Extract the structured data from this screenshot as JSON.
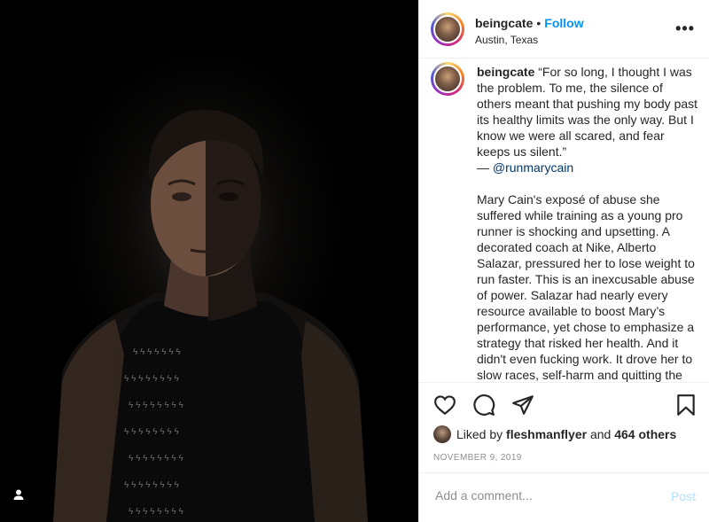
{
  "post": {
    "username": "beingcate",
    "separator": "•",
    "follow_label": "Follow",
    "location": "Austin, Texas",
    "more_label": "•••"
  },
  "caption": {
    "username": "beingcate",
    "quote": "“For so long, I thought I was the problem. To me, the silence of others meant that pushing my body past its healthy limits was the only way. But I know we were all scared, and fear keeps us silent.”",
    "attribution_prefix": "— ",
    "attribution_mention": "@runmarycain",
    "body": "Mary Cain's exposé of abuse she suffered while training as a young pro runner is shocking and upsetting. A decorated coach at Nike, Alberto Salazar, pressured her to lose weight to run faster. This is an inexcusable abuse of power. Salazar had nearly every resource available to boost Mary’s performance, yet chose to emphasize a strategy that risked her health. And it didn't even fucking work. It drove her to slow races, self-harm and quitting the"
  },
  "likes": {
    "prefix": "Liked by",
    "user": "fleshmanflyer",
    "conjunction": "and",
    "others": "464 others"
  },
  "date": "NOVEMBER 9, 2019",
  "comment": {
    "placeholder": "Add a comment...",
    "post_label": "Post"
  },
  "icons": {
    "like": "heart-icon",
    "comment": "comment-icon",
    "share": "paper-plane-icon",
    "save": "bookmark-icon",
    "tagged": "person-icon"
  },
  "colors": {
    "follow": "#0095f6",
    "mention": "#00376b",
    "post_disabled": "#b2dffc",
    "muted": "#8e8e8e"
  }
}
